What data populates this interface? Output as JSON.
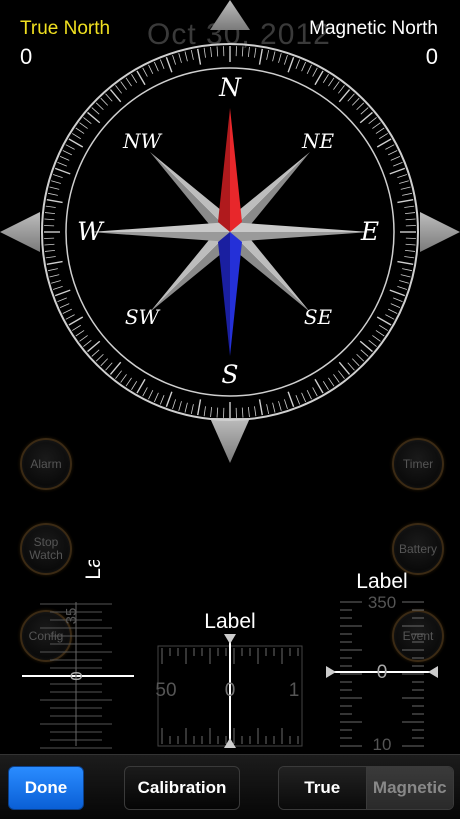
{
  "header": {
    "true_north_label": "True North",
    "true_north_value": "0",
    "magnetic_north_label": "Magnetic North",
    "magnetic_north_value": "0",
    "date": "Oct 30, 2012"
  },
  "compass": {
    "cardinals": {
      "n": "N",
      "s": "S",
      "e": "E",
      "w": "W"
    },
    "intercardinals": {
      "ne": "NE",
      "nw": "NW",
      "se": "SE",
      "sw": "SW"
    },
    "heading_deg": 0,
    "colors": {
      "north_needle": "#e8272b",
      "south_needle": "#2430d8",
      "rose": "#9a9a9a"
    }
  },
  "side_buttons": {
    "alarm": "Alarm",
    "timer": "Timer",
    "stopwatch_line1": "Stop",
    "stopwatch_line2": "Watch",
    "battery": "Battery",
    "config": "Config",
    "event": "Event"
  },
  "gauges": {
    "left": {
      "label": "Label",
      "value": "0",
      "scale_top": "35"
    },
    "center": {
      "label": "Label",
      "value": "0",
      "scale_left": "50",
      "scale_right": "1"
    },
    "right": {
      "label": "Label",
      "value": "0",
      "scale_top": "350",
      "scale_bottom": "10"
    }
  },
  "toolbar": {
    "done_label": "Done",
    "calibration_label": "Calibration",
    "segment_true": "True",
    "segment_magnetic": "Magnetic",
    "selected_segment": "True",
    "accent_color": "#1a74ee"
  }
}
